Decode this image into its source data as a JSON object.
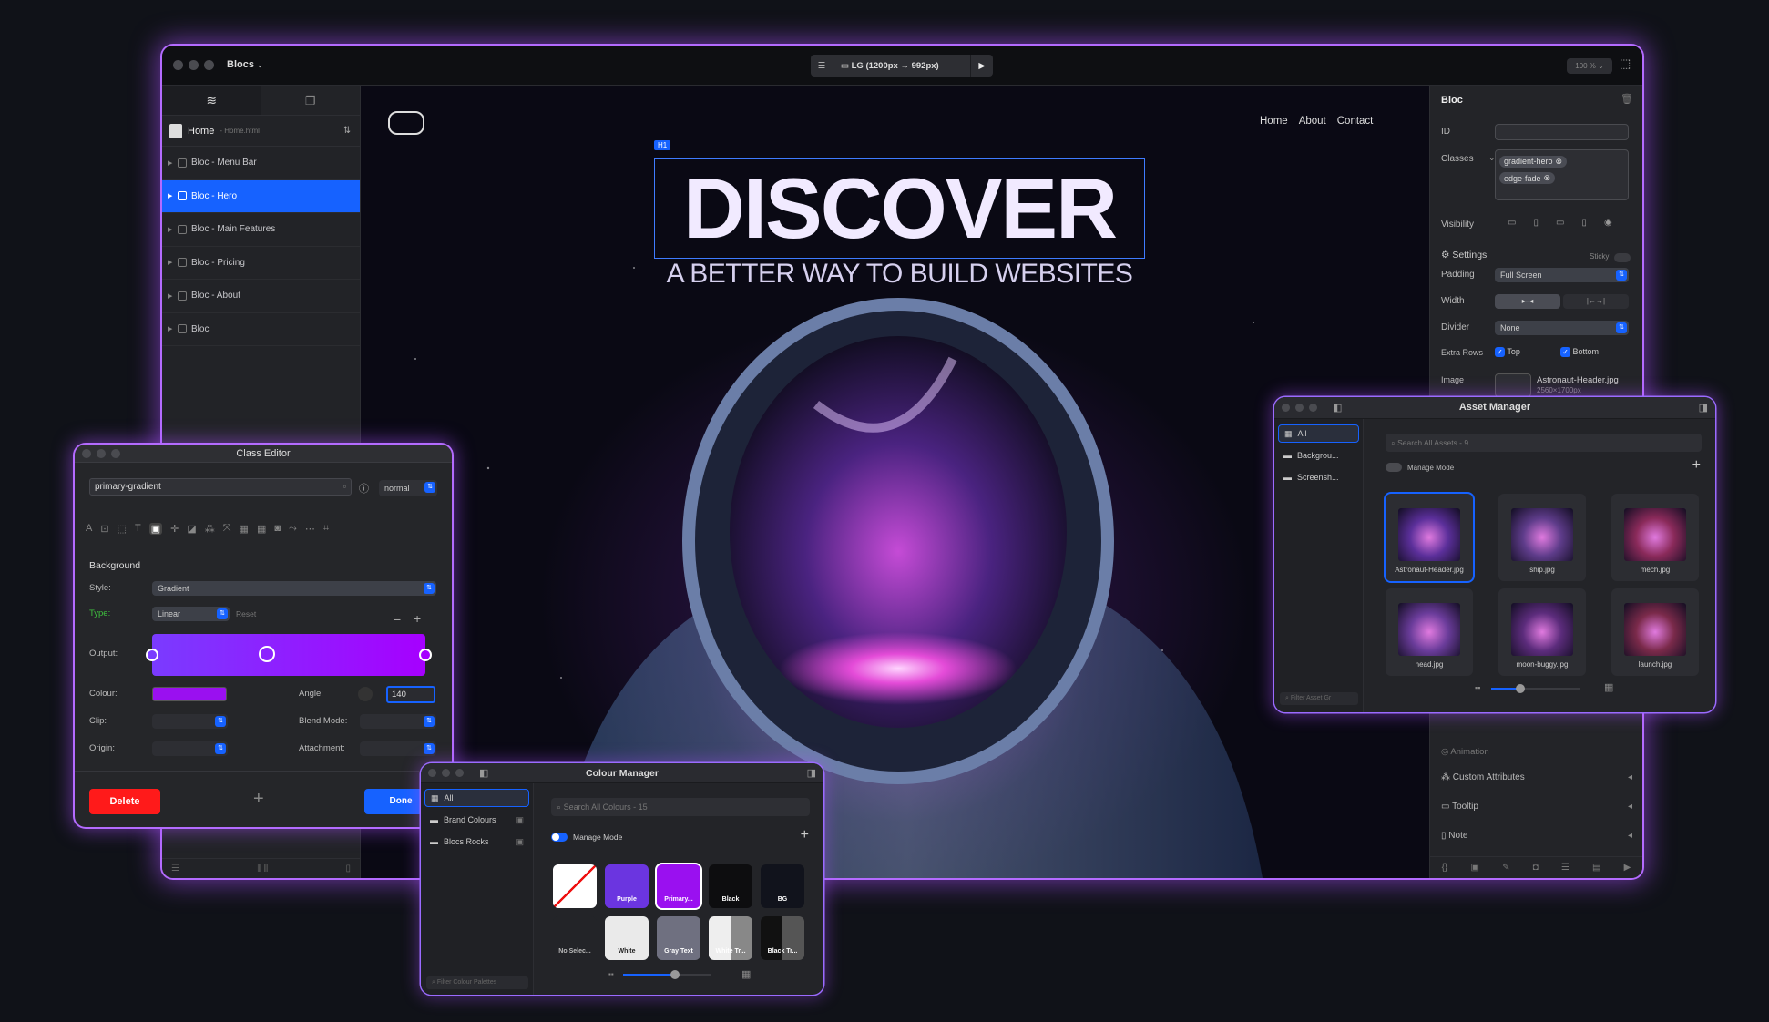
{
  "app": {
    "name": "Blocs"
  },
  "toolbar": {
    "viewport": "LG (1200px → 992px)",
    "zoom": "100 %"
  },
  "page_selector": {
    "label": "Home",
    "file": "- Home.html"
  },
  "tree": [
    {
      "label": "Bloc - Menu Bar"
    },
    {
      "label": "Bloc - Hero",
      "selected": true
    },
    {
      "label": "Bloc - Main Features"
    },
    {
      "label": "Bloc - Pricing"
    },
    {
      "label": "Bloc - About"
    },
    {
      "label": "Bloc"
    }
  ],
  "canvas": {
    "nav": [
      "Home",
      "About",
      "Contact"
    ],
    "h1_badge": "H1",
    "headline": "DISCOVER",
    "subheadline": "A BETTER WAY TO BUILD WEBSITES"
  },
  "inspector": {
    "title": "Bloc",
    "id_label": "ID",
    "classes_label": "Classes",
    "classes": [
      "gradient-hero",
      "edge-fade"
    ],
    "visibility_label": "Visibility",
    "settings_label": "Settings",
    "sticky_label": "Sticky",
    "padding_label": "Padding",
    "padding_value": "Full Screen",
    "width_label": "Width",
    "divider_label": "Divider",
    "divider_value": "None",
    "extra_rows_label": "Extra Rows",
    "top_label": "Top",
    "bottom_label": "Bottom",
    "image_label": "Image",
    "image_file": "Astronaut-Header.jpg",
    "image_size": "2560×1700px",
    "animation_label": "Animation",
    "custom_attr_label": "Custom Attributes",
    "tooltip_label": "Tooltip",
    "note_label": "Note"
  },
  "class_editor": {
    "title": "Class Editor",
    "class_name": "primary-gradient",
    "state": "normal",
    "section": "Background",
    "style_label": "Style:",
    "style_value": "Gradient",
    "type_label": "Type:",
    "type_value": "Linear",
    "reset_label": "Reset",
    "output_label": "Output:",
    "colour_label": "Colour:",
    "angle_label": "Angle:",
    "angle_value": "140",
    "clip_label": "Clip:",
    "blend_label": "Blend Mode:",
    "origin_label": "Origin:",
    "attachment_label": "Attachment:",
    "delete_label": "Delete",
    "done_label": "Done",
    "gradient_start": "#7a3bff",
    "gradient_end": "#a600ff"
  },
  "colour_manager": {
    "title": "Colour Manager",
    "sidebar": [
      {
        "label": "All",
        "selected": true
      },
      {
        "label": "Brand Colours"
      },
      {
        "label": "Blocs Rocks"
      }
    ],
    "search_placeholder": "Search All Colours - 15",
    "manage_mode_label": "Manage Mode",
    "filter_placeholder": "Filter Colour Palettes",
    "swatches": [
      {
        "label": "",
        "color": "#ffffff"
      },
      {
        "label": "Purple",
        "color": "#6b35e0"
      },
      {
        "label": "Primary...",
        "color": "#9a10f0"
      },
      {
        "label": "Black",
        "color": "#0d0d0f"
      },
      {
        "label": "BG",
        "color": "#11131c"
      },
      {
        "label": "No Selec...",
        "color": "#232428"
      },
      {
        "label": "White",
        "color": "#eaeaea"
      },
      {
        "label": "Gray Text",
        "color": "#6f7080"
      },
      {
        "label": "White Tr...",
        "color": "#d0d0d0"
      },
      {
        "label": "Black Tr...",
        "color": "#1a1a1a"
      }
    ]
  },
  "asset_manager": {
    "title": "Asset Manager",
    "sidebar": [
      {
        "label": "All",
        "selected": true
      },
      {
        "label": "Backgrou..."
      },
      {
        "label": "Screensh..."
      }
    ],
    "search_placeholder": "Search All Assets - 9",
    "manage_mode_label": "Manage Mode",
    "filter_placeholder": "Filter Asset Gr",
    "assets": [
      {
        "label": "Astronaut-Header.jpg",
        "color": "#5b2f9a"
      },
      {
        "label": "ship.jpg",
        "color": "#5e3c8a"
      },
      {
        "label": "mech.jpg",
        "color": "#8a2a5a"
      },
      {
        "label": "head.jpg",
        "color": "#6a3c9a"
      },
      {
        "label": "moon-buggy.jpg",
        "color": "#5c2c7c"
      },
      {
        "label": "launch.jpg",
        "color": "#7a2a4a"
      }
    ]
  }
}
